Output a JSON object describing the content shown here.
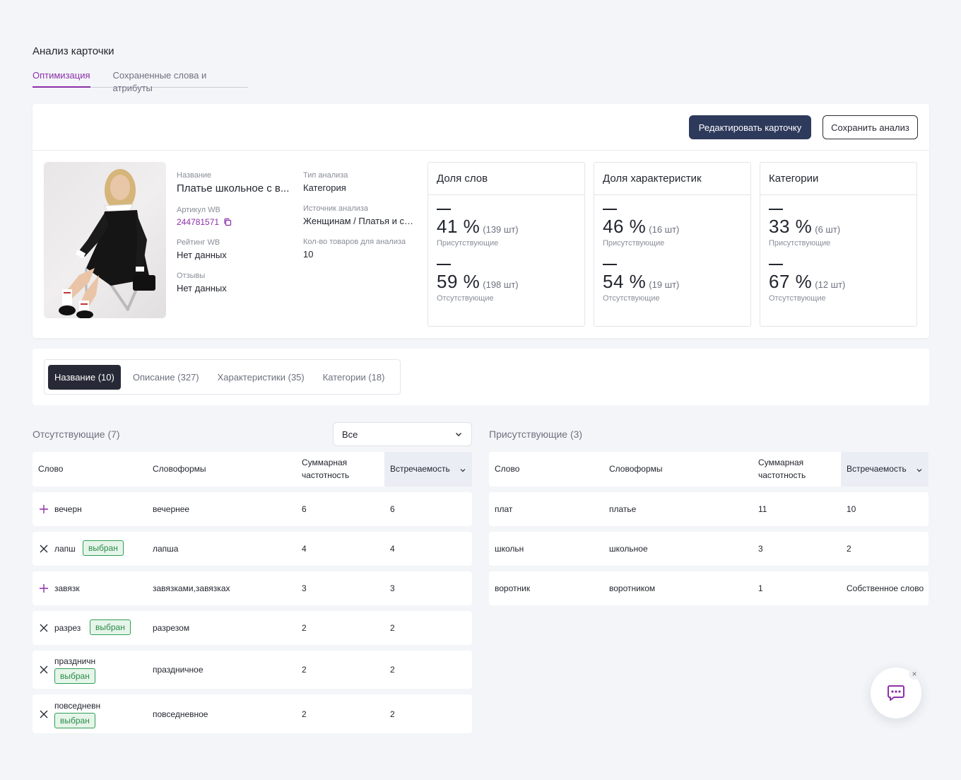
{
  "page": {
    "title": "Анализ карточки"
  },
  "top_tabs": [
    {
      "label": "Оптимизация",
      "active": true
    },
    {
      "label": "Сохраненные слова и атрибуты",
      "active": false
    }
  ],
  "header": {
    "edit_label": "Редактировать карточку",
    "save_label": "Сохранить анализ"
  },
  "product": {
    "name_label": "Название",
    "name_value": "Платье школьное с в...",
    "sku_label": "Артикул WB",
    "sku_value": "244781571",
    "rating_label": "Рейтинг WB",
    "rating_value": "Нет данных",
    "reviews_label": "Отзывы",
    "reviews_value": "Нет данных",
    "type_label": "Тип анализа",
    "type_value": "Категория",
    "source_label": "Источник анализа",
    "source_value": "Женщинам / Платья и сар...",
    "count_label": "Кол-во товаров для анализа",
    "count_value": "10"
  },
  "stats": [
    {
      "title": "Доля слов",
      "present_pct": "41 %",
      "present_cnt": "(139 шт)",
      "present_cap": "Присутствующие",
      "absent_pct": "59 %",
      "absent_cnt": "(198 шт)",
      "absent_cap": "Отсутствующие"
    },
    {
      "title": "Доля характеристик",
      "present_pct": "46 %",
      "present_cnt": "(16 шт)",
      "present_cap": "Присутствующие",
      "absent_pct": "54 %",
      "absent_cnt": "(19 шт)",
      "absent_cap": "Отсутствующие"
    },
    {
      "title": "Категории",
      "present_pct": "33 %",
      "present_cnt": "(6 шт)",
      "present_cap": "Присутствующие",
      "absent_pct": "67 %",
      "absent_cnt": "(12 шт)",
      "absent_cap": "Отсутствующие"
    }
  ],
  "segments": [
    {
      "label": "Название (10)",
      "active": true
    },
    {
      "label": "Описание (327)",
      "active": false
    },
    {
      "label": "Характеристики (35)",
      "active": false
    },
    {
      "label": "Категории (18)",
      "active": false
    }
  ],
  "absent": {
    "title": "Отсутствующие (7)",
    "filter_value": "Все",
    "columns": {
      "word": "Слово",
      "forms": "Словоформы",
      "freq": "Суммарная частотность",
      "occur": "Встречаемость"
    },
    "rows": [
      {
        "action": "plus",
        "word": "вечерн",
        "badge": "",
        "forms": "вечернее",
        "freq": "6",
        "occur": "6"
      },
      {
        "action": "x",
        "word": "лапш",
        "badge": "выбран",
        "forms": "лапша",
        "freq": "4",
        "occur": "4"
      },
      {
        "action": "plus",
        "word": "завязк",
        "badge": "",
        "forms": "завязками,завязках",
        "freq": "3",
        "occur": "3"
      },
      {
        "action": "x",
        "word": "разрез",
        "badge": "выбран",
        "forms": "разрезом",
        "freq": "2",
        "occur": "2"
      },
      {
        "action": "x",
        "word": "праздничн",
        "badge": "выбран",
        "forms": "праздничное",
        "freq": "2",
        "occur": "2"
      },
      {
        "action": "x",
        "word": "повседневн",
        "badge": "выбран",
        "forms": "повседневное",
        "freq": "2",
        "occur": "2"
      }
    ]
  },
  "present": {
    "title": "Присутствующие (3)",
    "columns": {
      "word": "Слово",
      "forms": "Словоформы",
      "freq": "Суммарная частотность",
      "occur": "Встречаемость"
    },
    "rows": [
      {
        "word": "плат",
        "forms": "платье",
        "freq": "11",
        "occur": "10"
      },
      {
        "word": "школьн",
        "forms": "школьное",
        "freq": "3",
        "occur": "2"
      },
      {
        "word": "воротник",
        "forms": "воротником",
        "freq": "1",
        "occur": "Собственное слово"
      }
    ]
  },
  "chat": {
    "close_symbol": "×"
  },
  "colors": {
    "accent": "#8b2fa8",
    "primary_button": "#2e3a5c",
    "badge_green": "#2f9e55"
  }
}
